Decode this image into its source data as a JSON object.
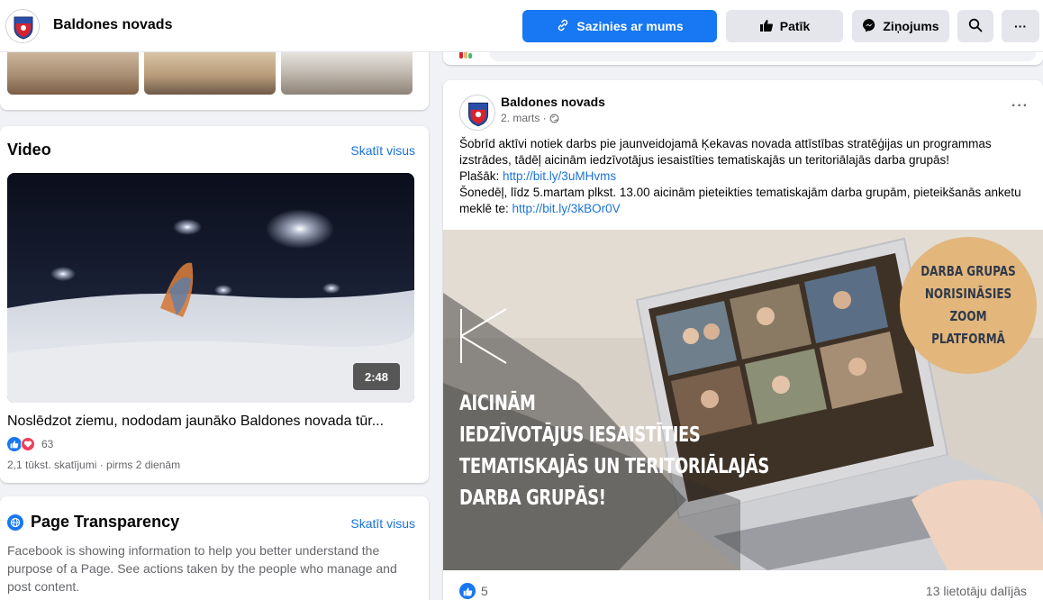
{
  "header": {
    "page_name": "Baldones novads",
    "contact_label": "Sazinies ar mums",
    "like_label": "Patīk",
    "message_label": "Ziņojums",
    "more_label": "···"
  },
  "video_section": {
    "title": "Video",
    "see_all": "Skatīt visus",
    "duration": "2:48",
    "caption": "Noslēdzot ziemu, nododam jaunāko Baldones novada tūr...",
    "reaction_count": "63",
    "meta": "2,1 tūkst. skatījumi · pirms 2 dienām"
  },
  "transparency": {
    "title": "Page Transparency",
    "see_all": "Skatīt visus",
    "text": "Facebook is showing information to help you better understand the purpose of a Page. See actions taken by the people who manage and post content."
  },
  "post": {
    "author": "Baldones novads",
    "time": "2. marts · ",
    "more": "···",
    "text_line1": "Šobrīd aktīvi notiek darbs pie jaunveidojamā Ķekavas novada attīstības stratēģijas un programmas izstrādes, tādēļ aicinām iedzīvotājus iesaistīties tematiskajās un teritoriālajās darba grupās!",
    "more_prefix": "Plašāk: ",
    "link1": "http://bit.ly/3uMHvms",
    "text_line2": "Šonedēļ, līdz 5.martam plkst. 13.00 aicinām pieteikties tematiskajām darba grupām, pieteikšanās anketu meklē te: ",
    "link2": "http://bit.ly/3kBOr0V",
    "image_headline": [
      "AICINĀM",
      "IEDZĪVOTĀJUS IESAISTĪTIES",
      "TEMATISKAJĀS UN TERITORIĀLAJĀS",
      "DARBA GRUPĀS!"
    ],
    "image_badge": [
      "DARBA GRUPAS",
      "NORISINĀSIES",
      "ZOOM PLATFORMĀ"
    ],
    "likes": "5",
    "shares": "13 lietotāju dalījās"
  },
  "colors": {
    "accent": "#1877f2",
    "link": "#1a73d9",
    "badge": "#e3b67c"
  }
}
